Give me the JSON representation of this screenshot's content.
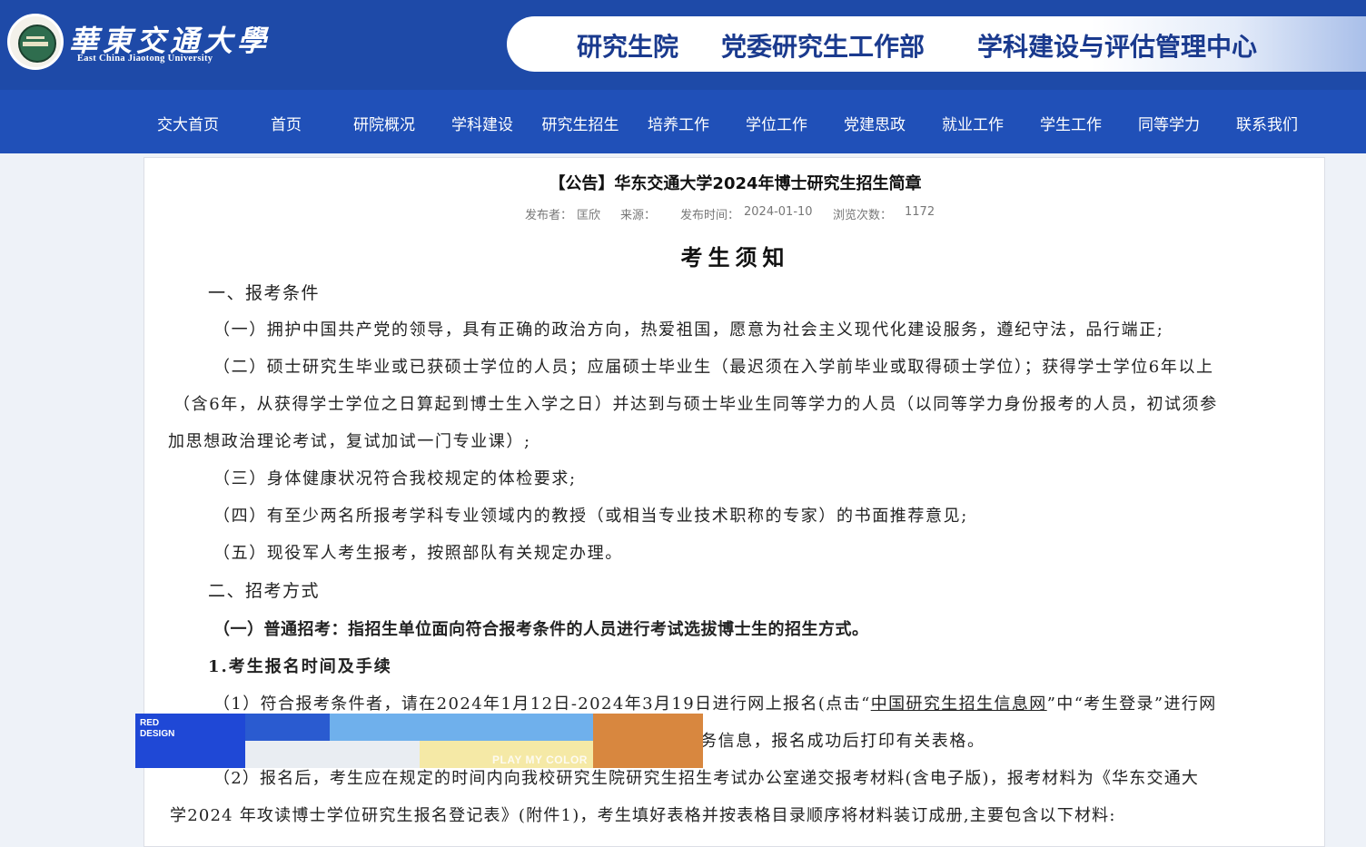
{
  "header": {
    "logo_cn": "華東交通大學",
    "logo_en": "East China Jiaotong University",
    "banner": [
      "研究生院",
      "党委研究生工作部",
      "学科建设与评估管理中心"
    ]
  },
  "nav": [
    "交大首页",
    "首页",
    "研院概况",
    "学科建设",
    "研究生招生",
    "培养工作",
    "学位工作",
    "党建思政",
    "就业工作",
    "学生工作",
    "同等学力",
    "联系我们"
  ],
  "article": {
    "title": "【公告】华东交通大学2024年博士研究生招生简章",
    "meta": {
      "publisher_label": "发布者：",
      "publisher": "匡欣",
      "source_label": "来源：",
      "date_label": "发布时间：",
      "date": "2024-01-10",
      "views_label": "浏览次数：",
      "views": "1172"
    },
    "notice_title": "考生须知",
    "sec1_heading": "一、报考条件",
    "c1": "（一）拥护中国共产党的领导，具有正确的政治方向，热爱祖国，愿意为社会主义现代化建设服务，遵纪守法，品行端正;",
    "c2_l1": "（二）硕士研究生毕业或已获硕士学位的人员；应届硕士毕业生（最迟须在入学前毕业或取得硕士学位）；获得学士学位6年以上",
    "c2_l2": "（含6年，从获得学士学位之日算起到博士生入学之日）并达到与硕士毕业生同等学力的人员（以同等学力身份报考的人员，初试须参",
    "c2_l3": "加思想政治理论考试，复试加试一门专业课）;",
    "c3": "（三）身体健康状况符合我校规定的体检要求;",
    "c4": "（四）有至少两名所报考学科专业领域内的教授（或相当专业技术职称的专家）的书面推荐意见;",
    "c5": "（五）现役军人考生报考，按照部队有关规定办理。",
    "sec2_heading": "二、招考方式",
    "m1": "（一）普通招考：指招生单位面向符合报考条件的人员进行考试选拔博士生的招生方式。",
    "sub1": "1.考生报名时间及手续",
    "r1_pre": "（1）符合报考条件者，请在2024年1月12日-2024年3月19日进行网上报名(点击“",
    "r1_link": "中国研究生招生信息网",
    "r1_post": "”中“考生登录”进行网",
    "r1_l2": "务信息，报名成功后打印有关表格。",
    "r2_l1": "（2）报名后，考生应在规定的时间内向我校研究生院研究生招生考试办公室递交报考材料(含电子版)，报考材料为《华东交通大",
    "r2_l2": "学2024 年攻读博士学位研究生报名登记表》(附件1)，考生填好表格并按表格目录顺序将材料装订成册,主要包含以下材料:"
  },
  "overlay": {
    "label_line1": "RED",
    "label_line2": "DESIGN",
    "caption": "PLAY MY COLOR",
    "colors": [
      "#1f48d6",
      "#2a5bd0",
      "#6fb0ec",
      "#d8873f",
      "#e9edf2",
      "#f5e9a6"
    ]
  }
}
